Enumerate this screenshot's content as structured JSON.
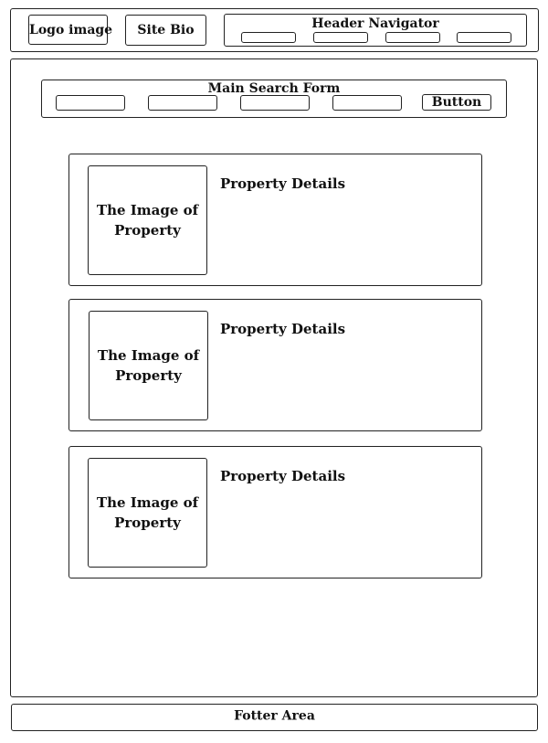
{
  "header": {
    "logo_label": "Logo image",
    "bio_label": "Site Bio",
    "nav_title": "Header Navigator",
    "nav_links": [
      "",
      "",
      "",
      ""
    ]
  },
  "search": {
    "title": "Main Search Form",
    "fields": [
      "",
      "",
      "",
      ""
    ],
    "button_label": "Button"
  },
  "listings": [
    {
      "image_label": "The Image of Property",
      "details_label": "Property Details"
    },
    {
      "image_label": "The Image of Property",
      "details_label": "Property Details"
    },
    {
      "image_label": "The Image of Property",
      "details_label": "Property Details"
    }
  ],
  "footer": {
    "label": "Fotter Area"
  }
}
